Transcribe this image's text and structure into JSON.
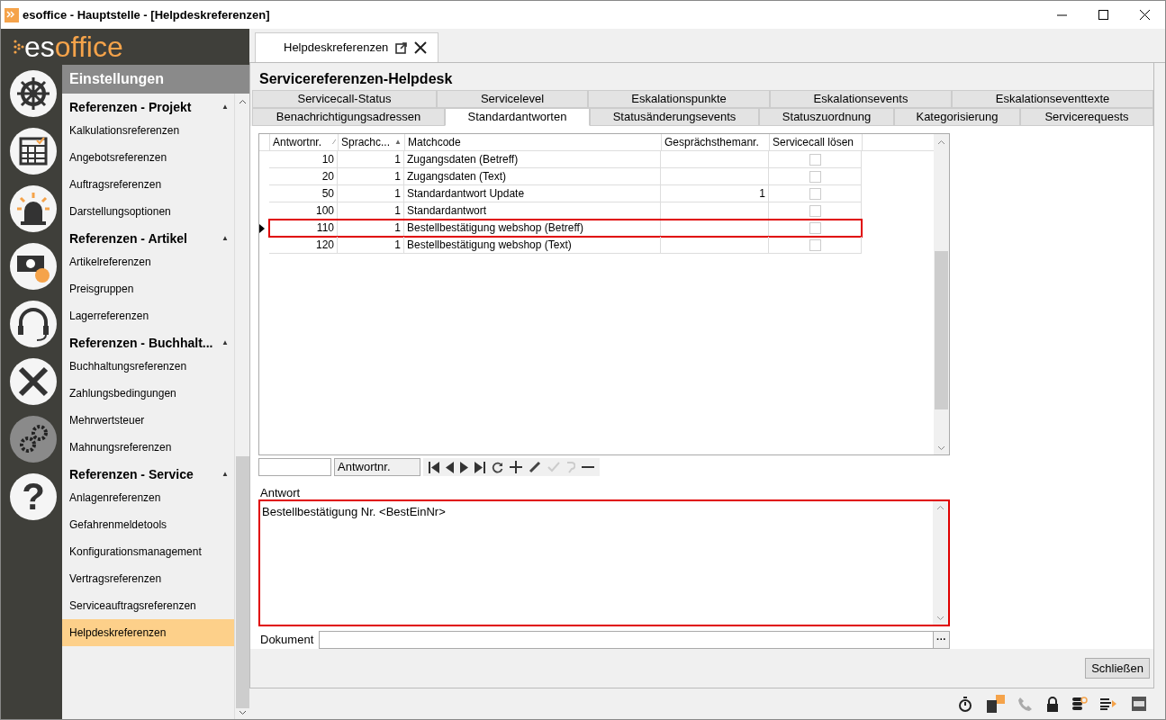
{
  "window": {
    "title": "esoffice - Hauptstelle - [Helpdeskreferenzen]"
  },
  "logo": {
    "part1": "es",
    "part2": "office"
  },
  "module_icons": [
    {
      "selected": false
    },
    {
      "selected": false
    },
    {
      "selected": false
    },
    {
      "selected": false
    },
    {
      "selected": false
    },
    {
      "selected": false
    },
    {
      "selected": true
    },
    {
      "selected": false,
      "glyph": "?"
    }
  ],
  "nav": {
    "title": "Einstellungen",
    "items": [
      {
        "kind": "header",
        "label": "Referenzen - Projekt",
        "toggle": "▲"
      },
      {
        "kind": "item",
        "label": "Kalkulationsreferenzen",
        "selected": false
      },
      {
        "kind": "item",
        "label": "Angebotsreferenzen",
        "selected": false
      },
      {
        "kind": "item",
        "label": "Auftragsreferenzen",
        "selected": false
      },
      {
        "kind": "item",
        "label": "Darstellungsoptionen",
        "selected": false
      },
      {
        "kind": "header",
        "label": "Referenzen - Artikel",
        "toggle": "▲"
      },
      {
        "kind": "item",
        "label": "Artikelreferenzen",
        "selected": false
      },
      {
        "kind": "item",
        "label": "Preisgruppen",
        "selected": false
      },
      {
        "kind": "item",
        "label": "Lagerreferenzen",
        "selected": false
      },
      {
        "kind": "header",
        "label": "Referenzen - Buchhalt...",
        "toggle": "▲"
      },
      {
        "kind": "item",
        "label": "Buchhaltungsreferenzen",
        "selected": false
      },
      {
        "kind": "item",
        "label": "Zahlungsbedingungen",
        "selected": false
      },
      {
        "kind": "item",
        "label": "Mehrwertsteuer",
        "selected": false
      },
      {
        "kind": "item",
        "label": "Mahnungsreferenzen",
        "selected": false
      },
      {
        "kind": "header",
        "label": "Referenzen - Service",
        "toggle": "▲"
      },
      {
        "kind": "item",
        "label": "Anlagenreferenzen",
        "selected": false
      },
      {
        "kind": "item",
        "label": "Gefahrenmeldetools",
        "selected": false
      },
      {
        "kind": "item",
        "label": "Konfigurationsmanagement",
        "selected": false
      },
      {
        "kind": "item",
        "label": "Vertragsreferenzen",
        "selected": false
      },
      {
        "kind": "item",
        "label": "Serviceauftragsreferenzen",
        "selected": false
      },
      {
        "kind": "item",
        "label": "Helpdeskreferenzen",
        "selected": true
      }
    ]
  },
  "document_tab": {
    "label": "Helpdeskreferenzen"
  },
  "page_title": "Servicereferenzen-Helpdesk",
  "tab_rows": [
    [
      {
        "label": "Servicecall-Status",
        "selected": false
      },
      {
        "label": "Servicelevel",
        "selected": false
      },
      {
        "label": "Eskalationspunkte",
        "selected": false
      },
      {
        "label": "Eskalationsevents",
        "selected": false
      },
      {
        "label": "Eskalationseventtexte",
        "selected": false
      }
    ],
    [
      {
        "label": "Benachrichtigungsadressen",
        "selected": false
      },
      {
        "label": "Standardantworten",
        "selected": true
      },
      {
        "label": "Statusänderungsevents",
        "selected": false
      },
      {
        "label": "Statuszuordnung",
        "selected": false
      },
      {
        "label": "Kategorisierung",
        "selected": false
      },
      {
        "label": "Servicerequests",
        "selected": false
      }
    ]
  ],
  "table": {
    "columns": [
      {
        "label": "Antwortnr.",
        "sort": "⁄"
      },
      {
        "label": "Sprachc...",
        "sort": "▲"
      },
      {
        "label": "Matchcode"
      },
      {
        "label": "Gesprächsthemanr."
      },
      {
        "label": "Servicecall lösen"
      }
    ],
    "rows": [
      {
        "nr": "10",
        "lang": "1",
        "matchcode": "Zugangsdaten (Betreff)",
        "topic": "",
        "solve": false,
        "selected": false
      },
      {
        "nr": "20",
        "lang": "1",
        "matchcode": "Zugangsdaten (Text)",
        "topic": "",
        "solve": false,
        "selected": false
      },
      {
        "nr": "50",
        "lang": "1",
        "matchcode": "Standardantwort Update",
        "topic": "1",
        "solve": false,
        "selected": false
      },
      {
        "nr": "100",
        "lang": "1",
        "matchcode": "Standardantwort",
        "topic": "",
        "solve": false,
        "selected": false
      },
      {
        "nr": "110",
        "lang": "1",
        "matchcode": "Bestellbestätigung webshop (Betreff)",
        "topic": "",
        "solve": false,
        "selected": true
      },
      {
        "nr": "120",
        "lang": "1",
        "matchcode": "Bestellbestätigung webshop (Text)",
        "topic": "",
        "solve": false,
        "selected": false
      }
    ]
  },
  "navigator": {
    "search_column": "Antwortnr."
  },
  "answer": {
    "label": "Antwort",
    "value": "Bestellbestätigung Nr. <BestEinNr>"
  },
  "document": {
    "label": "Dokument",
    "browse": "···"
  },
  "close_button": "Schließen"
}
